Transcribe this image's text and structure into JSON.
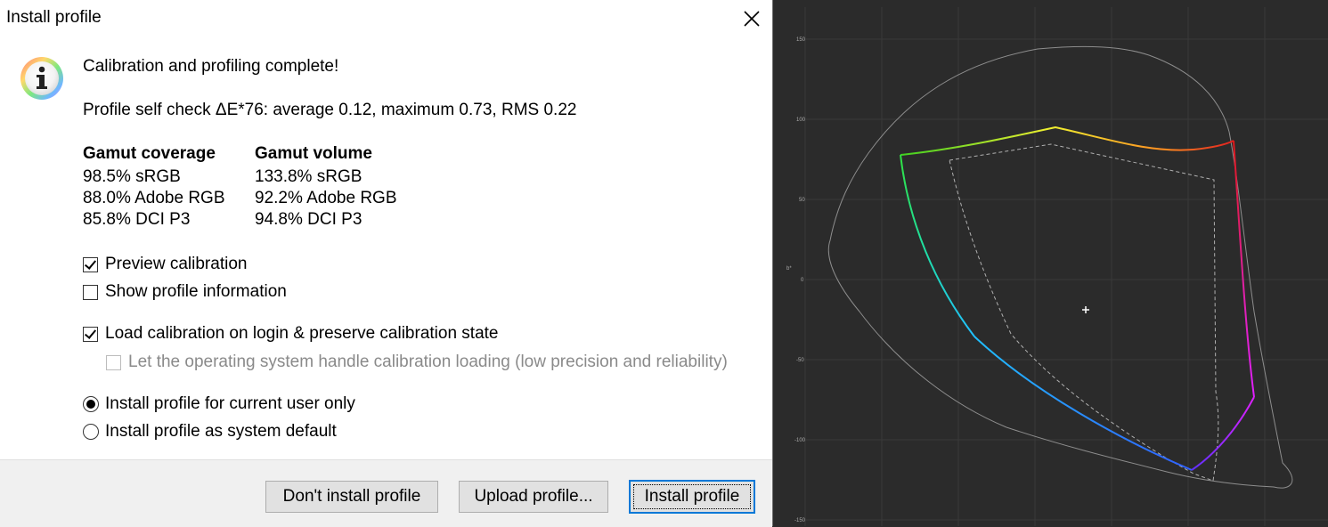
{
  "dialog": {
    "title": "Install profile",
    "heading": "Calibration and profiling complete!",
    "self_check": "Profile self check ΔE*76: average 0.12, maximum 0.73, RMS 0.22",
    "coverage_header": "Gamut coverage",
    "volume_header": "Gamut volume",
    "coverage": [
      "98.5% sRGB",
      "88.0% Adobe RGB",
      "85.8% DCI P3"
    ],
    "volume": [
      "133.8% sRGB",
      "92.2% Adobe RGB",
      "94.8% DCI P3"
    ],
    "checkboxes": [
      {
        "label": "Preview calibration",
        "checked": true,
        "enabled": true
      },
      {
        "label": "Show profile information",
        "checked": false,
        "enabled": true
      },
      {
        "label": "Load calibration on login & preserve calibration state",
        "checked": true,
        "enabled": true
      },
      {
        "label": "Let the operating system handle calibration loading (low precision and reliability)",
        "checked": false,
        "enabled": false
      }
    ],
    "radios": [
      {
        "label": "Install profile for current user only",
        "checked": true
      },
      {
        "label": "Install profile as system default",
        "checked": false
      }
    ],
    "buttons": {
      "dont_install": "Don't install profile",
      "upload": "Upload profile...",
      "install": "Install profile"
    }
  },
  "gamut_plot": {
    "y_ticks": [
      "150",
      "100",
      "50",
      "0",
      "-50",
      "-100",
      "-150"
    ],
    "y_axis_label": "b*",
    "background": "#2b2b2b",
    "grid_color": "#3a3a3a"
  }
}
